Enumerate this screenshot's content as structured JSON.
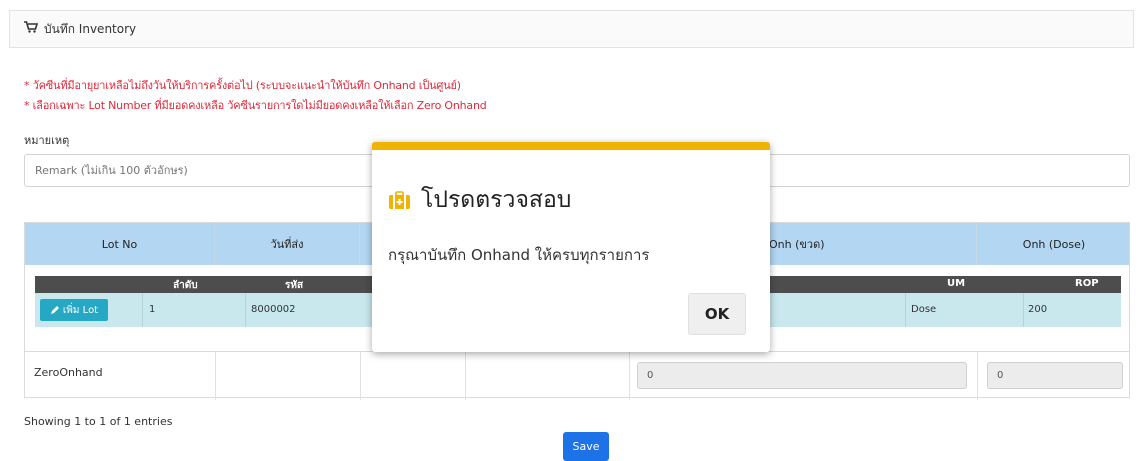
{
  "header": {
    "title": "บันทึก Inventory",
    "icon": "cart-icon"
  },
  "notes": [
    "* วัคซีนที่มีอายุยาเหลือไม่ถึงวันให้บริการครั้งต่อไป (ระบบจะแนะนำให้บันทึก Onhand เป็นศูนย์)",
    "* เลือกเฉพาะ Lot Number ที่มียอดคงเหลือ วัคซีนรายการใดไม่มียอดคงเหลือให้เลือก Zero Onhand"
  ],
  "remark": {
    "label": "หมายเหตุ",
    "placeholder": "Remark (ไม่เกิน 100 ตัวอักษร)"
  },
  "grid": {
    "columns": [
      "Lot No",
      "วันที่ส่ง",
      "",
      "",
      "Onh (ขวด)",
      "Onh (Dose)"
    ],
    "sub_columns": [
      "ลำดับ",
      "รหัส",
      "UM",
      "ROP"
    ],
    "row": {
      "add_lot_label": "เพิ่ม Lot",
      "seq": "1",
      "code": "8000002",
      "um": "Dose",
      "rop": "200"
    },
    "zero_row": {
      "label": "ZeroOnhand",
      "onh_bottle": "0",
      "onh_dose": "0"
    }
  },
  "footer": {
    "entries": "Showing 1 to 1 of 1 entries",
    "save_label": "Save"
  },
  "modal": {
    "title": "โปรดตรวจสอบ",
    "message": "กรุณาบันทึก Onhand ให้ครบทุกรายการ",
    "ok_label": "OK",
    "icon": "medical-kit-icon",
    "accent": "#f0b400"
  },
  "colors": {
    "note": "#e0293b",
    "header_blue": "#b3d7f3",
    "add_lot": "#25a8c4",
    "save": "#1d72e8"
  }
}
